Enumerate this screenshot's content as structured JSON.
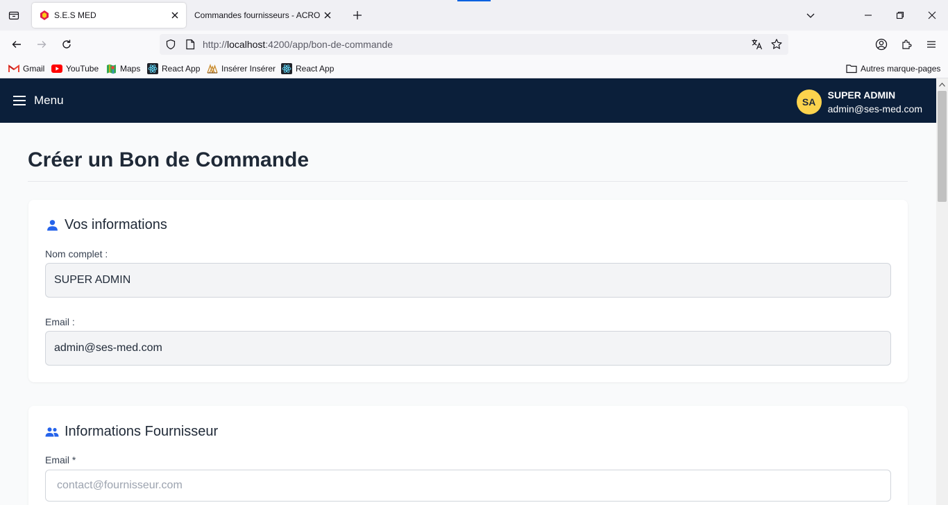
{
  "browser": {
    "tabs": [
      {
        "title": "S.E.S MED",
        "active": true
      },
      {
        "title": "Commandes fournisseurs - ACROBAT",
        "active": false
      }
    ],
    "url_prefix": "http://",
    "url_host": "localhost",
    "url_path": ":4200/app/bon-de-commande",
    "bookmarks": [
      {
        "label": "Gmail",
        "icon": "gmail-icon"
      },
      {
        "label": "YouTube",
        "icon": "youtube-icon"
      },
      {
        "label": "Maps",
        "icon": "maps-icon"
      },
      {
        "label": "React App",
        "icon": "react-icon"
      },
      {
        "label": "Insérer Insérer",
        "icon": "inserer-icon"
      },
      {
        "label": "React App",
        "icon": "react-icon"
      }
    ],
    "other_bookmarks": "Autres marque-pages",
    "accent_color": "#0061e0"
  },
  "header": {
    "menu_label": "Menu",
    "avatar_initials": "SA",
    "user_name": "SUPER ADMIN",
    "user_email": "admin@ses-med.com",
    "bg_color": "#0b1f3a",
    "avatar_color": "#fcd34d"
  },
  "page": {
    "title": "Créer un Bon de Commande"
  },
  "sections": {
    "info": {
      "title": "Vos informations",
      "icon": "user-icon",
      "name_label": "Nom complet :",
      "name_value": "SUPER ADMIN",
      "email_label": "Email :",
      "email_value": "admin@ses-med.com"
    },
    "supplier": {
      "title": "Informations Fournisseur",
      "icon": "users-icon",
      "email_label": "Email *",
      "email_placeholder": "contact@fournisseur.com"
    }
  },
  "accent_blue": "#2563eb"
}
